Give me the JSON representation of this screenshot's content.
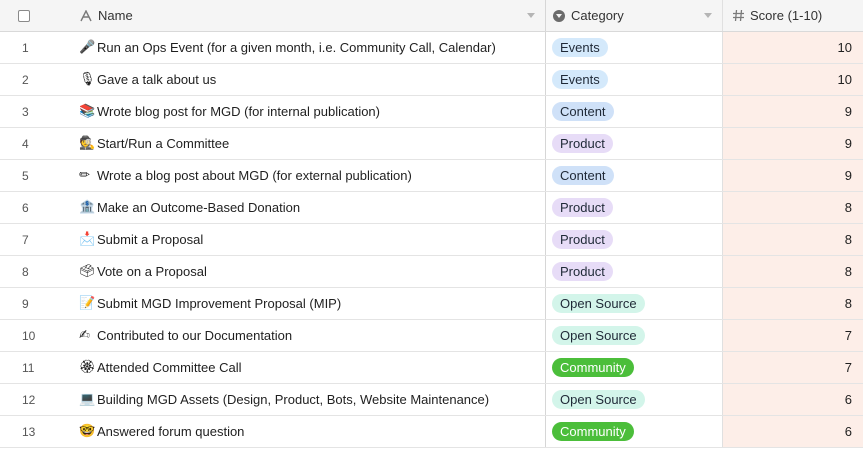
{
  "header": {
    "name_label": "Name",
    "category_label": "Category",
    "score_label": "Score (1-10)",
    "name_icon": "text-field-icon",
    "category_icon": "single-select-icon",
    "score_icon": "number-field-icon"
  },
  "colors": {
    "events": "#d4e9fb",
    "content": "#cfe1f8",
    "product": "#e7dcf7",
    "open_source": "#d3f5ea",
    "community": "#4bbe3a",
    "score_column_bg": "#fdeee8"
  },
  "rows": [
    {
      "num": "1",
      "emoji": "🎤",
      "emoji_name": "microphone",
      "name": "Run an Ops Event (for a given month, i.e. Community Call, Calendar)",
      "category": "Events",
      "cat_class": "events",
      "score": "10"
    },
    {
      "num": "2",
      "emoji": "🎙",
      "emoji_name": "studio-microphone",
      "name": "Gave a talk about us",
      "category": "Events",
      "cat_class": "events",
      "score": "10"
    },
    {
      "num": "3",
      "emoji": "📚",
      "emoji_name": "books",
      "name": "Wrote blog post for MGD (for internal publication)",
      "category": "Content",
      "cat_class": "content",
      "score": "9"
    },
    {
      "num": "4",
      "emoji": "🕵",
      "emoji_name": "detective",
      "name": "Start/Run a Committee",
      "category": "Product",
      "cat_class": "product",
      "score": "9"
    },
    {
      "num": "5",
      "emoji": "✏",
      "emoji_name": "pencil",
      "name": "Wrote a blog post about MGD (for external publication)",
      "category": "Content",
      "cat_class": "content",
      "score": "9"
    },
    {
      "num": "6",
      "emoji": "🏦",
      "emoji_name": "bank",
      "name": "Make an Outcome-Based Donation",
      "category": "Product",
      "cat_class": "product",
      "score": "8"
    },
    {
      "num": "7",
      "emoji": "📩",
      "emoji_name": "envelope-with-arrow",
      "name": "Submit a Proposal",
      "category": "Product",
      "cat_class": "product",
      "score": "8"
    },
    {
      "num": "8",
      "emoji": "🗳",
      "emoji_name": "ballot-box",
      "name": "Vote on a Proposal",
      "category": "Product",
      "cat_class": "product",
      "score": "8"
    },
    {
      "num": "9",
      "emoji": "📝",
      "emoji_name": "memo",
      "name": "Submit MGD Improvement Proposal (MIP)",
      "category": "Open Source",
      "cat_class": "opensource",
      "score": "8"
    },
    {
      "num": "10",
      "emoji": "✍",
      "emoji_name": "writing-hand",
      "name": "Contributed to our Documentation",
      "category": "Open Source",
      "cat_class": "opensource",
      "score": "7"
    },
    {
      "num": "11",
      "emoji": "🏵",
      "emoji_name": "rosette",
      "name": "Attended Committee Call",
      "category": "Community",
      "cat_class": "community",
      "score": "7"
    },
    {
      "num": "12",
      "emoji": "💻",
      "emoji_name": "laptop",
      "name": "Building MGD Assets (Design, Product, Bots, Website Maintenance)",
      "category": "Open Source",
      "cat_class": "opensource",
      "score": "6"
    },
    {
      "num": "13",
      "emoji": "🤓",
      "emoji_name": "nerd-face",
      "name": "Answered forum question",
      "category": "Community",
      "cat_class": "community",
      "score": "6"
    }
  ]
}
